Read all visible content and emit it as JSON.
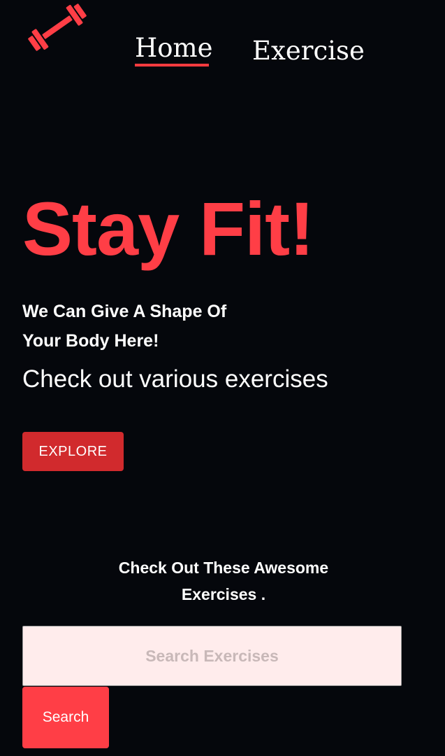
{
  "header": {
    "logo_icon": "dumbbell-icon",
    "accent_color": "#ff3e46"
  },
  "nav": {
    "items": [
      {
        "label": "Home",
        "active": true
      },
      {
        "label": "Exercise",
        "active": false
      }
    ]
  },
  "hero": {
    "title": "Stay Fit!",
    "tagline": "We Can Give A Shape Of Your Body Here!",
    "subtitle": "Check out various exercises",
    "explore_label": "EXPLORE",
    "explore_color": "#d12a2d"
  },
  "search": {
    "heading": "Check Out These Awesome Exercises .",
    "placeholder": "Search Exercises",
    "value": "",
    "button_label": "Search"
  }
}
